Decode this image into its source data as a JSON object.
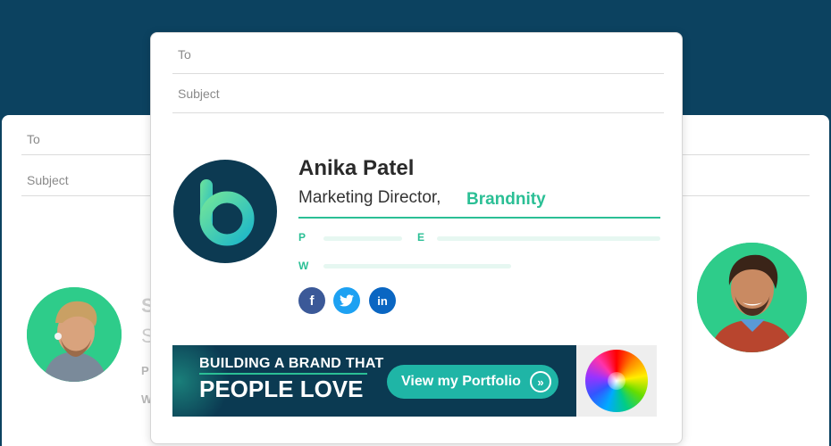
{
  "background_card": {
    "to_label": "To",
    "subject_label": "Subject",
    "ghost_name": "S",
    "ghost_title": "S",
    "ghost_p": "P",
    "ghost_w": "W"
  },
  "compose": {
    "to_label": "To",
    "subject_label": "Subject"
  },
  "signature": {
    "name": "Anika Patel",
    "title": "Marketing Director,",
    "company": "Brandnity",
    "phone_label": "P",
    "email_label": "E",
    "web_label": "W",
    "social_icons": [
      "facebook-icon",
      "twitter-icon",
      "linkedin-icon"
    ],
    "social": {
      "facebook": "f",
      "twitter": "t",
      "linkedin": "in"
    }
  },
  "banner": {
    "line1": "BUILDING A BRAND THAT",
    "line2": "PEOPLE LOVE",
    "cta_label": "View my Portfolio",
    "cta_icon": "double-chevron-right-icon"
  },
  "colors": {
    "background": "#0c4260",
    "accent": "#2bbf95",
    "banner": "#0b3a52",
    "cta": "#1fb5a6"
  }
}
